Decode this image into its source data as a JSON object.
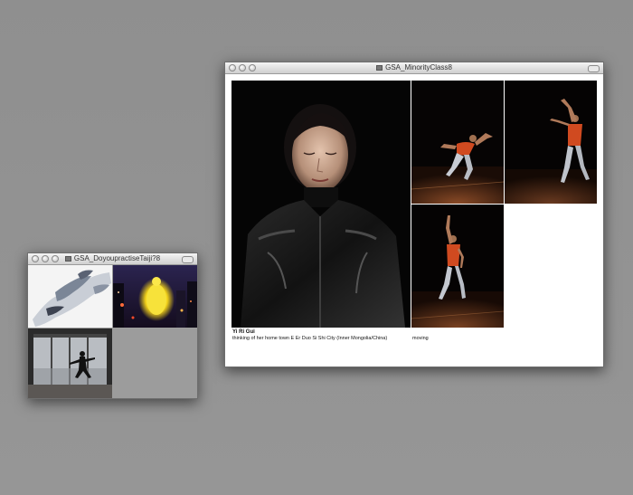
{
  "window_left": {
    "title": "GSA_DoyoupractiseTaiji?8"
  },
  "window_right": {
    "title": "GSA_MinorityClass8",
    "caption": {
      "name": "Yi Ri Gui",
      "description": "thinking of her home town E Er Duo Si Shi City (Inner Mongolia/China)",
      "secondary": "moving"
    }
  },
  "colors": {
    "desktop": "#929292",
    "window_bg": "#ffffff",
    "photo_dark": "#050505"
  }
}
